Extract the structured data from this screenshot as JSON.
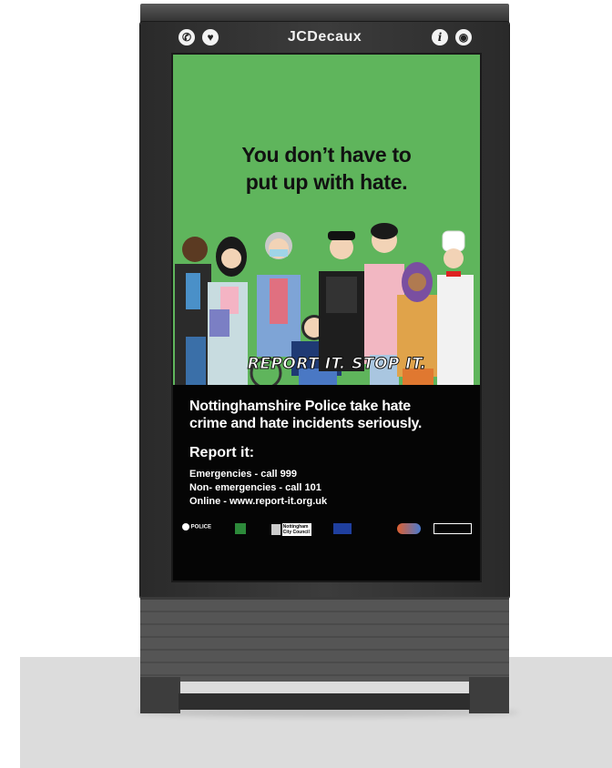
{
  "kiosk": {
    "brand": "JCDecaux",
    "left_icons": [
      "phone-icon",
      "defibrillator-icon"
    ],
    "right_icons": [
      "info-icon",
      "wifi-icon"
    ]
  },
  "poster": {
    "headline_line1": "You don’t have to",
    "headline_line2": "put up with hate.",
    "tagline": "REPORT IT. STOP IT.",
    "body_title_line1": "Nottinghamshire Police take hate",
    "body_title_line2": "crime and hate incidents seriously.",
    "report_heading": "Report it:",
    "contacts": [
      "Emergencies - call 999",
      "Non- emergencies - call 101",
      "Online - www.report-it.org.uk"
    ],
    "colors": {
      "green": "#5fb55c",
      "black": "#050505"
    }
  },
  "logos": [
    {
      "name": "police-logo",
      "text": "POLICE"
    },
    {
      "name": "council-crest-logo",
      "text": "Nottingham City Council"
    }
  ]
}
